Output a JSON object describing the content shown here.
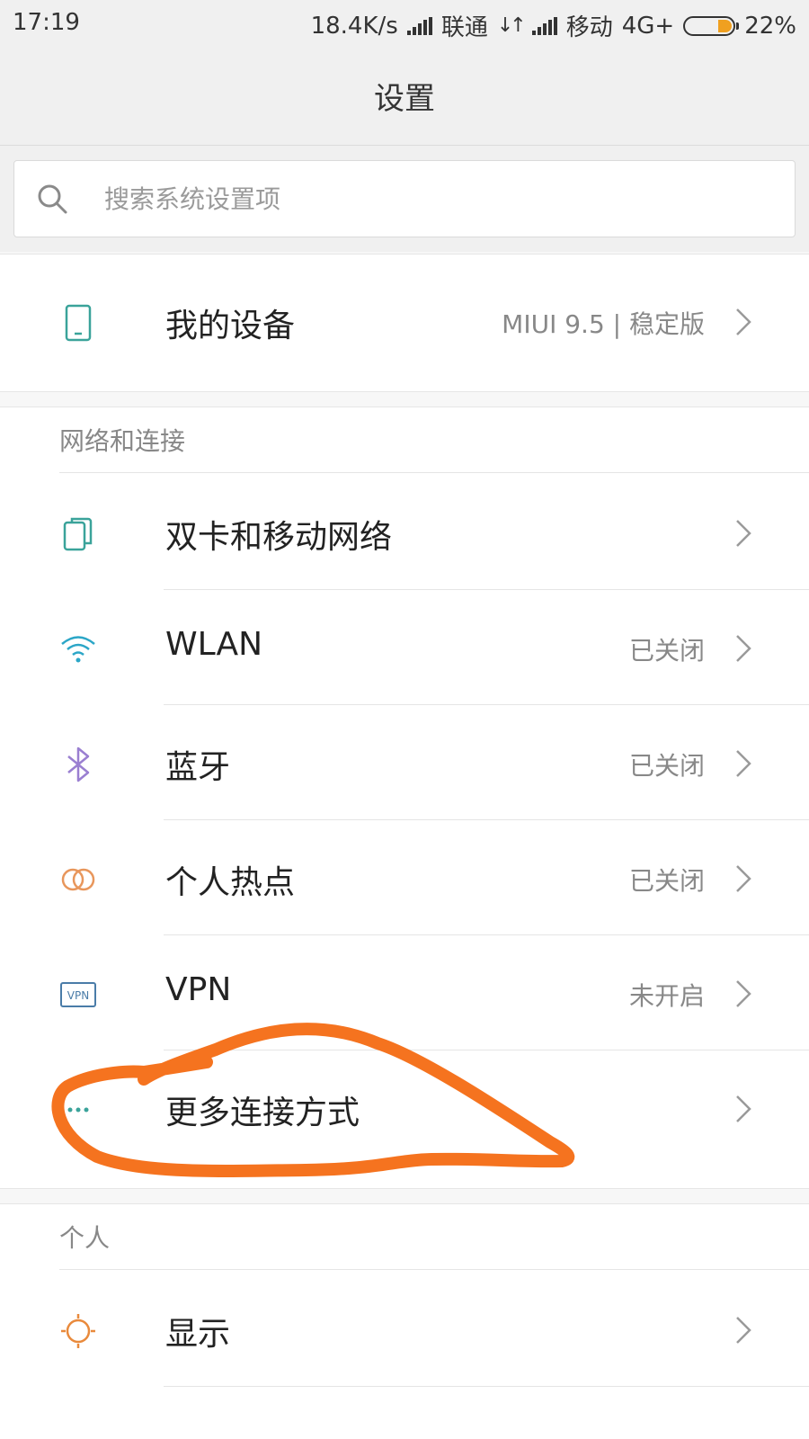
{
  "status_bar": {
    "time": "17:19",
    "net_speed": "18.4K/s",
    "carrier1": "联通",
    "carrier2": "移动",
    "network_type": "4G+",
    "battery": "22%"
  },
  "header": {
    "title": "设置"
  },
  "search": {
    "placeholder": "搜索系统设置项"
  },
  "device": {
    "label": "我的设备",
    "value": "MIUI 9.5 | 稳定版",
    "icon": "phone-icon"
  },
  "network": {
    "header": "网络和连接",
    "items": [
      {
        "label": "双卡和移动网络",
        "value": "",
        "icon": "dual-sim-icon"
      },
      {
        "label": "WLAN",
        "value": "已关闭",
        "icon": "wifi-icon"
      },
      {
        "label": "蓝牙",
        "value": "已关闭",
        "icon": "bluetooth-icon"
      },
      {
        "label": "个人热点",
        "value": "已关闭",
        "icon": "hotspot-icon"
      },
      {
        "label": "VPN",
        "value": "未开启",
        "icon": "vpn-icon"
      },
      {
        "label": "更多连接方式",
        "value": "",
        "icon": "more-icon"
      }
    ]
  },
  "personal": {
    "header": "个人",
    "items": [
      {
        "label": "显示",
        "value": "",
        "icon": "display-icon"
      }
    ]
  },
  "colors": {
    "annotation_stroke": "#f5731f",
    "sim_icon": "#3aa39a",
    "wifi_icon": "#2ba6c7",
    "bluetooth_icon": "#9a7fd1",
    "hotspot_icon": "#e8965b",
    "vpn_icon": "#4a7ca8",
    "display_icon": "#e98a3c"
  }
}
